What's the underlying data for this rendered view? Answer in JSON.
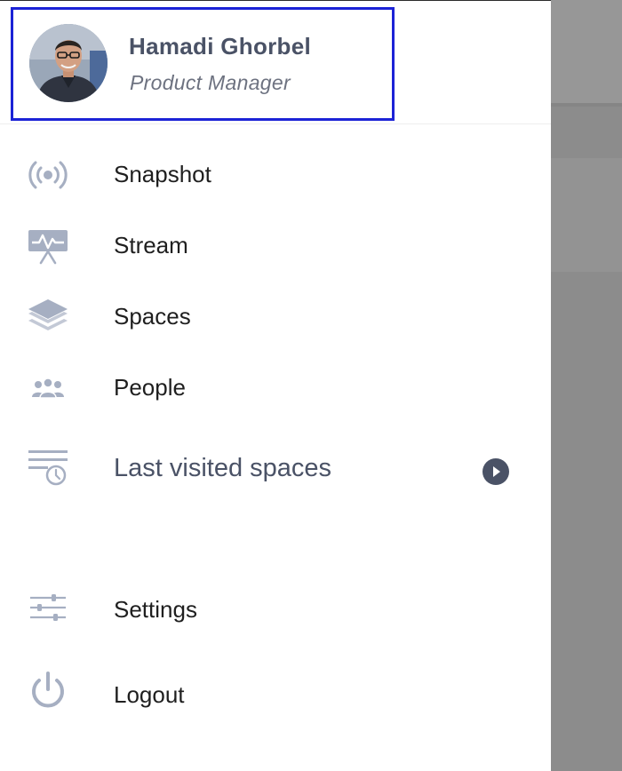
{
  "profile": {
    "name": "Hamadi Ghorbel",
    "role": "Product Manager",
    "avatar_icon": "user-avatar-photo"
  },
  "menu": {
    "items": [
      {
        "label": "Snapshot",
        "icon": "broadcast-icon"
      },
      {
        "label": "Stream",
        "icon": "activity-stream-icon"
      },
      {
        "label": "Spaces",
        "icon": "layers-icon"
      },
      {
        "label": "People",
        "icon": "people-icon"
      },
      {
        "label": "Last visited spaces",
        "icon": "recent-list-clock-icon",
        "action_icon": "play-circle-icon"
      }
    ],
    "footer": [
      {
        "label": "Settings",
        "icon": "sliders-icon"
      },
      {
        "label": "Logout",
        "icon": "power-icon"
      }
    ]
  },
  "colors": {
    "icon": "#a6afc2",
    "accent": "#4a5266",
    "selection_border": "#1c23d6",
    "backdrop": "#8c8c8c"
  }
}
